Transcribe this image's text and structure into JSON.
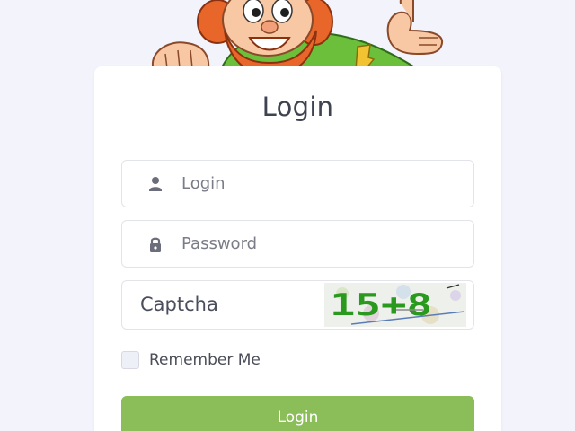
{
  "card": {
    "title": "Login"
  },
  "form": {
    "login": {
      "placeholder": "Login",
      "value": "",
      "icon": "user-icon"
    },
    "password": {
      "placeholder": "Password",
      "value": "",
      "icon": "lock-icon"
    },
    "captcha": {
      "placeholder": "Captcha",
      "value": "",
      "image_text": "15+8"
    },
    "remember_label": "Remember Me",
    "remember_checked": false,
    "submit_label": "Login"
  },
  "colors": {
    "background": "#f3f3fc",
    "button": "#8bbd58",
    "title": "#3f4350"
  },
  "mascot": {
    "icon": "leprechaun-mascot"
  }
}
